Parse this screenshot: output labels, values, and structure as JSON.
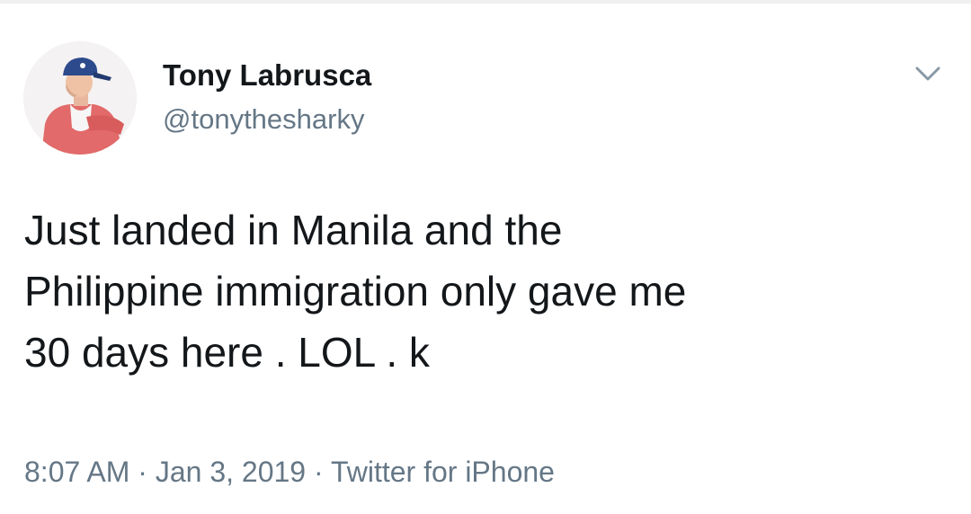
{
  "tweet": {
    "author": {
      "display_name": "Tony Labrusca",
      "handle": "@tonythesharky",
      "avatar_icon": "profile-photo"
    },
    "menu_icon": "chevron-down-icon",
    "text_lines": [
      "Just landed in Manila and the",
      "Philippine immigration only gave me",
      "30 days here . LOL . k"
    ],
    "meta": {
      "time": "8:07 AM",
      "separator": " · ",
      "date": "Jan 3, 2019",
      "source": "Twitter for iPhone"
    }
  },
  "colors": {
    "text_primary": "#14171a",
    "text_secondary": "#657786",
    "background": "#ffffff"
  }
}
